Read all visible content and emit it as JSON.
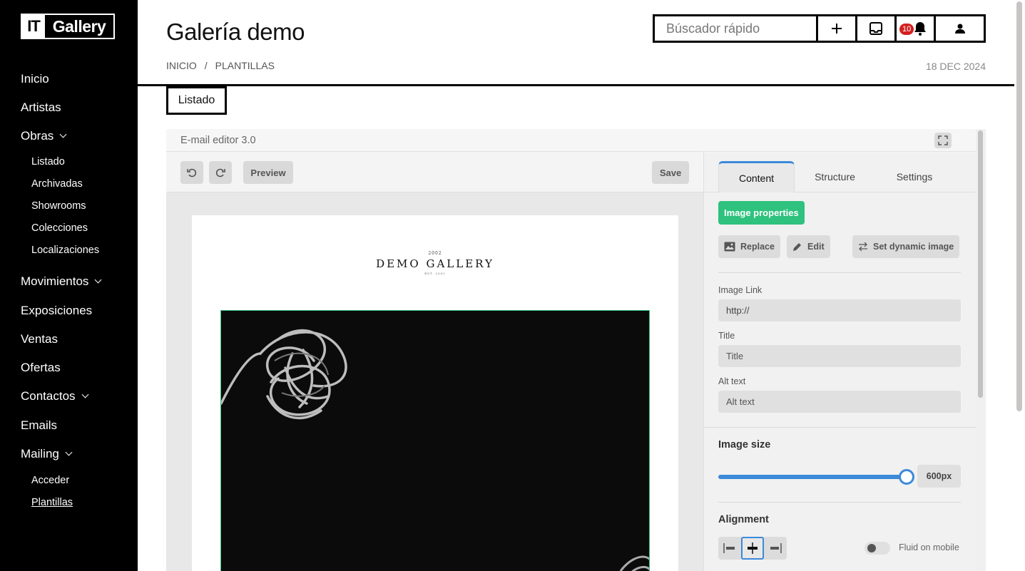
{
  "logo": {
    "left": "IT",
    "right": "Gallery"
  },
  "sidebar": {
    "items": [
      {
        "label": "Inicio"
      },
      {
        "label": "Artistas"
      },
      {
        "label": "Obras"
      },
      {
        "label": "Movimientos"
      },
      {
        "label": "Exposiciones"
      },
      {
        "label": "Ventas"
      },
      {
        "label": "Ofertas"
      },
      {
        "label": "Contactos"
      },
      {
        "label": "Emails"
      },
      {
        "label": "Mailing"
      }
    ],
    "obras_sub": [
      "Listado",
      "Archivadas",
      "Showrooms",
      "Colecciones",
      "Localizaciones"
    ],
    "mailing_sub": [
      "Acceder",
      "Plantillas"
    ],
    "active_sub": "Plantillas"
  },
  "header": {
    "title": "Galería demo",
    "breadcrumb": [
      "INICIO",
      "/",
      "PLANTILLAS"
    ],
    "date": "18 DEC 2024",
    "search_placeholder": "Búscador rápido",
    "notifications_count": "10"
  },
  "tab": {
    "label": "Listado"
  },
  "editor": {
    "title": "E-mail editor 3.0",
    "toolbar": {
      "preview": "Preview",
      "save": "Save"
    },
    "email": {
      "year": "2002",
      "brand": "DEMO GALLERY",
      "tagline": "EST. 2002"
    },
    "panel": {
      "tabs": [
        "Content",
        "Structure",
        "Settings"
      ],
      "active_tab": "Content",
      "image_properties": "Image properties",
      "buttons": {
        "replace": "Replace",
        "edit": "Edit",
        "dynamic": "Set dynamic image"
      },
      "image_link_label": "Image Link",
      "image_link_value": "http://",
      "title_label": "Title",
      "title_placeholder": "Title",
      "alt_label": "Alt text",
      "alt_placeholder": "Alt text",
      "image_size_label": "Image size",
      "image_size_value": "600px",
      "image_size_fraction": 1.0,
      "alignment_label": "Alignment",
      "alignment_active": "center",
      "fluid_label": "Fluid on mobile",
      "fluid_on": false
    }
  },
  "colors": {
    "accent": "#3b8ad9",
    "green": "#2ec27e",
    "badge": "#d42020",
    "sidebar": "#000000"
  }
}
